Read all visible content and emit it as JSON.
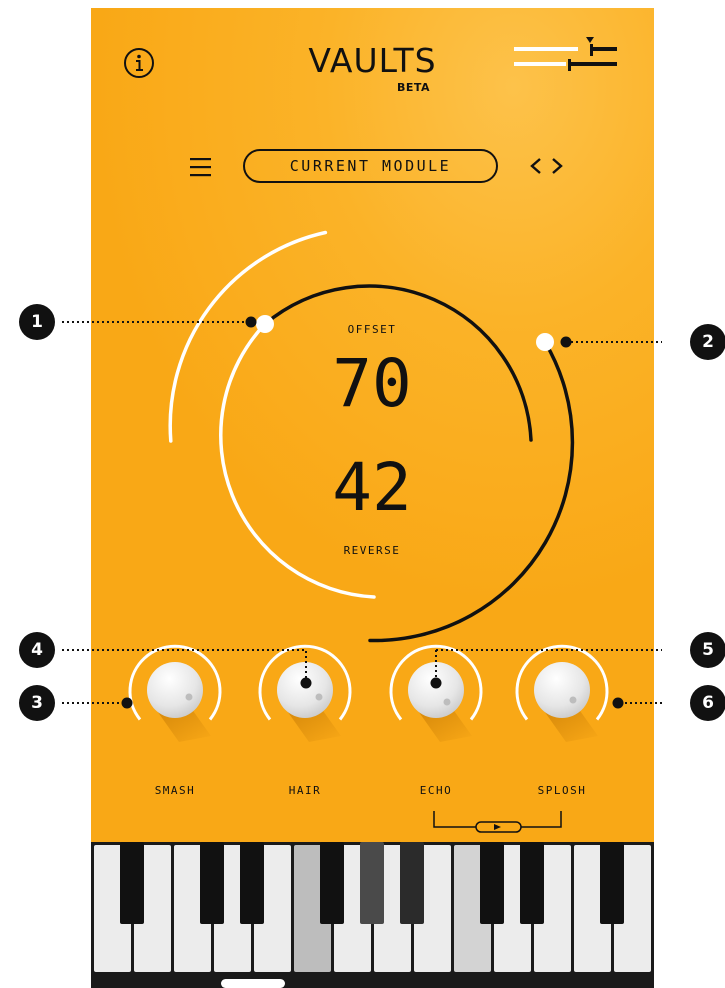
{
  "app": {
    "title": "VAULTS",
    "subtitle": "BETA"
  },
  "module": {
    "label": "CURRENT MODULE"
  },
  "dial": {
    "top_label": "OFFSET",
    "top_value": "70",
    "bottom_value": "42",
    "bottom_label": "REVERSE"
  },
  "knobs": [
    {
      "label": "SMASH"
    },
    {
      "label": "HAIR"
    },
    {
      "label": "ECHO"
    },
    {
      "label": "SPLOSH"
    }
  ],
  "callouts": [
    "1",
    "2",
    "3",
    "4",
    "5",
    "6"
  ],
  "icons": {
    "info": "info-icon",
    "mixer": "mixer-slider-icon",
    "menu": "hamburger-menu-icon",
    "nav_prev": "chevron-left-icon",
    "nav_next": "chevron-right-icon",
    "play": "play-icon"
  },
  "colors": {
    "background": "#fbb328",
    "ink": "#111111",
    "knob": "#e9e9e9",
    "ring": "#ffffff"
  }
}
